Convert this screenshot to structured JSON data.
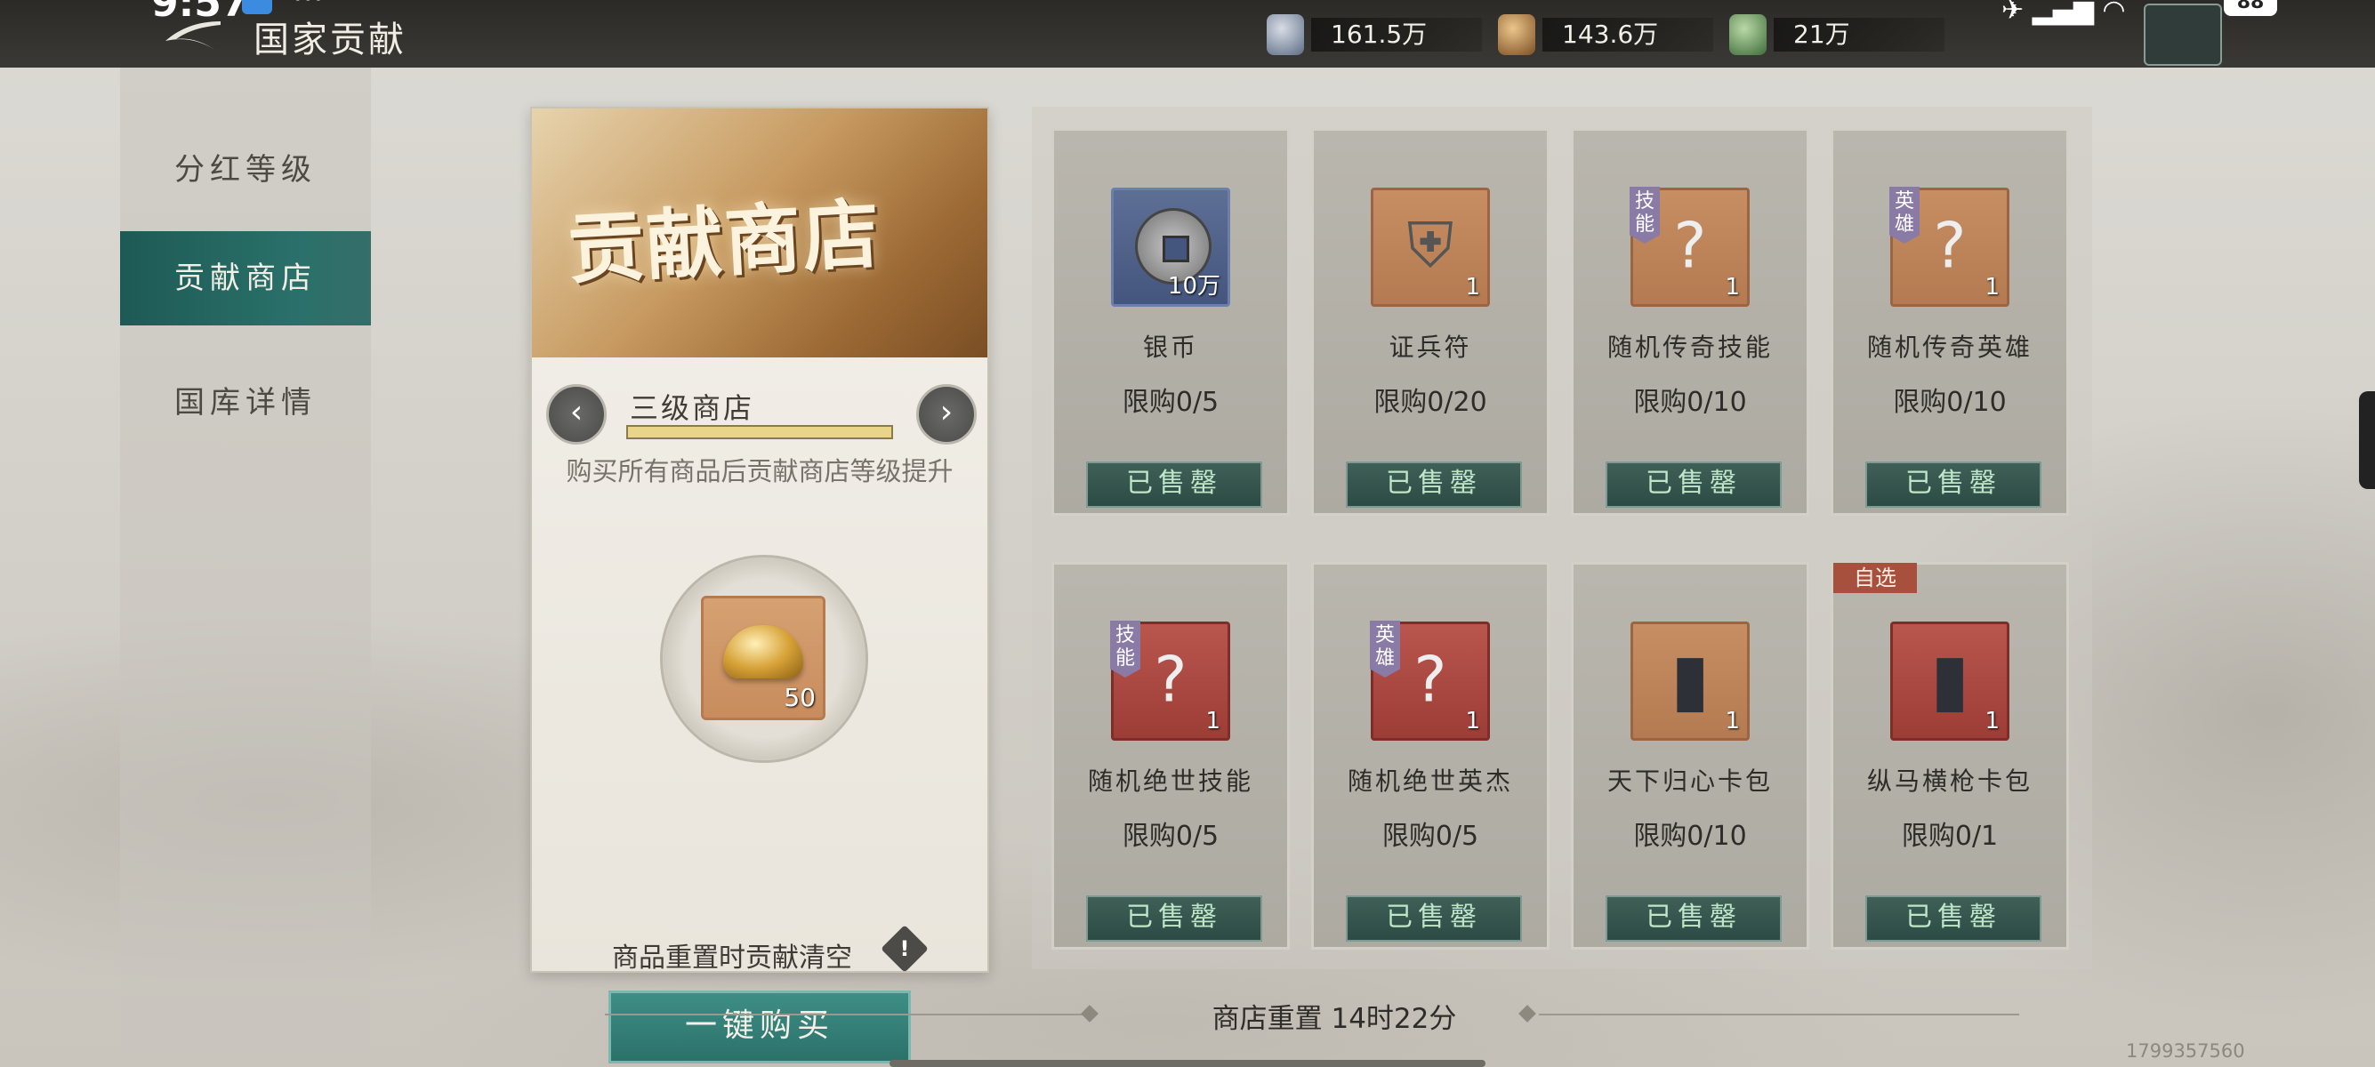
{
  "status_bar": {
    "time": "9:57",
    "more": "···",
    "battery": "88"
  },
  "header": {
    "title": "国家贡献"
  },
  "resources": [
    {
      "icon": "silver-bag-icon",
      "value": "161.5万"
    },
    {
      "icon": "copper-bag-icon",
      "value": "143.6万"
    },
    {
      "icon": "jade-pile-icon",
      "value": "21万"
    }
  ],
  "sidebar": {
    "items": [
      {
        "label": "分红等级",
        "active": false
      },
      {
        "label": "贡献商店",
        "active": true
      },
      {
        "label": "国库详情",
        "active": false
      }
    ]
  },
  "store_panel": {
    "banner_title": "贡献商店",
    "tier_label": "三级商店",
    "tier_progress": 1.0,
    "tier_hint": "购买所有商品后贡献商店等级提升",
    "currency_qty": "50",
    "reset_note": "商品重置时贡献清空",
    "warn_symbol": "!",
    "buy_all_label": "一键购买",
    "prev_symbol": "‹",
    "next_symbol": "›"
  },
  "items": [
    {
      "name": "银币",
      "limit": "限购0/5",
      "qty": "10万",
      "frame": "blue",
      "tag": "",
      "button": "已售罄"
    },
    {
      "name": "证兵符",
      "limit": "限购0/20",
      "qty": "1",
      "frame": "orange",
      "tag": "",
      "button": "已售罄"
    },
    {
      "name": "随机传奇技能",
      "limit": "限购0/10",
      "qty": "1",
      "frame": "orange",
      "tag": "技能",
      "button": "已售罄"
    },
    {
      "name": "随机传奇英雄",
      "limit": "限购0/10",
      "qty": "1",
      "frame": "orange",
      "tag": "英雄",
      "button": "已售罄"
    },
    {
      "name": "随机绝世技能",
      "limit": "限购0/5",
      "qty": "1",
      "frame": "red",
      "tag": "技能",
      "button": "已售罄"
    },
    {
      "name": "随机绝世英杰",
      "limit": "限购0/5",
      "qty": "1",
      "frame": "red",
      "tag": "英雄",
      "button": "已售罄"
    },
    {
      "name": "天下归心卡包",
      "limit": "限购0/10",
      "qty": "1",
      "frame": "orange",
      "tag": "",
      "button": "已售罄"
    },
    {
      "name": "纵马横枪卡包",
      "limit": "限购0/1",
      "qty": "1",
      "frame": "red",
      "tag": "",
      "button": "已售罄",
      "pick_tag": "自选"
    }
  ],
  "footer": {
    "reset_timer": "商店重置 14时22分",
    "uid": "1799357560"
  },
  "colors": {
    "accent_teal": "#2a706a",
    "sold_text": "#bfe6c8",
    "pick_tag": "#a8503e"
  }
}
